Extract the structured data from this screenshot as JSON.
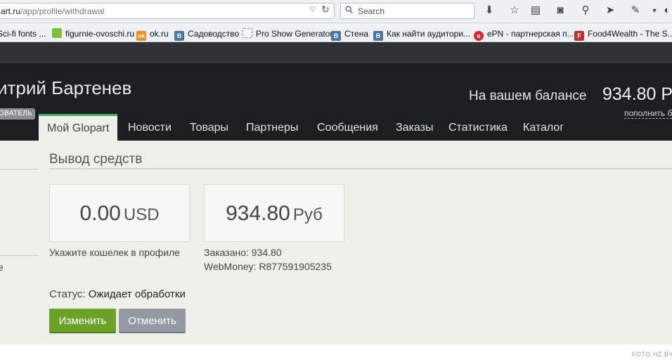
{
  "browser": {
    "url_host": "art.ru",
    "url_path": "/app/profile/withdrawal",
    "search_placeholder": "Search",
    "bookmarks": [
      {
        "label": "Sci-fi fonts ...",
        "icon": "page-icon"
      },
      {
        "label": "figurnie-ovoschi.ru",
        "icon": "plant-icon"
      },
      {
        "label": "ok.ru",
        "icon": "ok-icon"
      },
      {
        "label": "Садоводство",
        "icon": "vk-icon"
      },
      {
        "label": "Pro Show Generator",
        "icon": "blank-page-icon"
      },
      {
        "label": "Стена",
        "icon": "vk-icon"
      },
      {
        "label": "Как найти аудитори...",
        "icon": "vk-icon"
      },
      {
        "label": "ePN - партнерская п...",
        "icon": "epn-icon"
      },
      {
        "label": "Food4Wealth - The S...",
        "icon": "food-icon"
      }
    ]
  },
  "header": {
    "user_name": "итрий Бартенев",
    "user_role": "ОВАТЕЛЬ",
    "balance_label": "На вашем балансе",
    "balance_value": "934.80 Ру",
    "topup_label": "пополнить б"
  },
  "nav": {
    "tabs": [
      {
        "label": "Мой Glopart",
        "active": true
      },
      {
        "label": "Новости"
      },
      {
        "label": "Товары"
      },
      {
        "label": "Партнеры"
      },
      {
        "label": "Сообщения"
      },
      {
        "label": "Заказы"
      },
      {
        "label": "Статистика"
      },
      {
        "label": "Каталог"
      }
    ]
  },
  "main": {
    "sidebar_fragment": "е",
    "title": "Вывод средств",
    "wallets": [
      {
        "amount": "0.00",
        "currency": "USD",
        "note": "Укажите кошелек в профиле"
      },
      {
        "amount": "934.80",
        "currency": "Руб",
        "ordered": "Заказано: 934.80",
        "wallet": "WebMoney: R877591905235"
      }
    ],
    "status_label": "Статус:",
    "status_value": "Ожидает обработки",
    "change_button": "Изменить",
    "cancel_button": "Отменить"
  },
  "watermark": "FOTO.HZ.BY",
  "colors": {
    "accent_green": "#3db166",
    "button_green": "#6aa327",
    "button_gray": "#939aa3",
    "header_bg": "#1c1e21"
  }
}
